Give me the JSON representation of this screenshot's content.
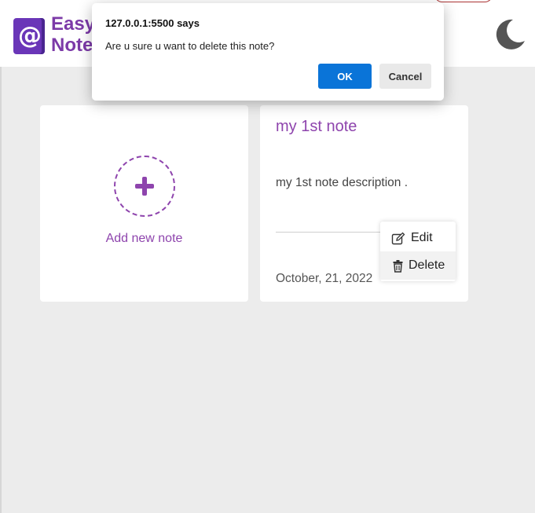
{
  "header": {
    "brand_line1": "Easy",
    "brand_line2": "Note",
    "logo_glyph": "@",
    "brand_color": "#7c3aa8",
    "theme_toggle_icon": "moon-icon"
  },
  "add_card": {
    "label": "Add new note",
    "icon": "plus-icon",
    "accent": "#8e44ad"
  },
  "note": {
    "title": "my 1st note",
    "description": "my 1st note description .",
    "date": "October, 21, 2022"
  },
  "context_menu": {
    "edit_label": "Edit",
    "delete_label": "Delete",
    "edit_icon": "pencil-square-icon",
    "delete_icon": "trash-icon"
  },
  "dialog": {
    "title": "127.0.0.1:5500 says",
    "message": "Are u sure u want to delete this note?",
    "ok_label": "OK",
    "cancel_label": "Cancel",
    "ok_color": "#0a74d8"
  }
}
